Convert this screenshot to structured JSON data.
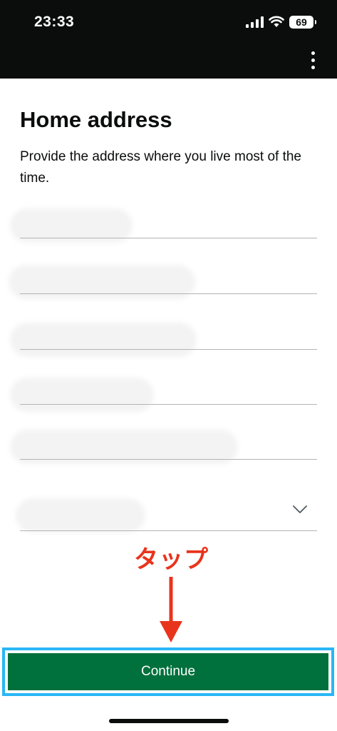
{
  "status_bar": {
    "time": "23:33",
    "battery": "69",
    "icons": [
      "cellular-signal-icon",
      "wifi-icon",
      "battery-icon"
    ]
  },
  "header": {
    "menu_icon": "vertical-ellipsis-icon"
  },
  "page": {
    "title": "Home address",
    "hint": "Provide the address where you live most of the time."
  },
  "form": {
    "dropdown_icon": "chevron-down-icon"
  },
  "annotation": {
    "text": "タップ",
    "color": "#e8341c",
    "arrow_icon": "down-arrow-icon"
  },
  "actions": {
    "continue_label": "Continue",
    "button_color": "#00703c",
    "highlight_color": "#29b6f6"
  }
}
